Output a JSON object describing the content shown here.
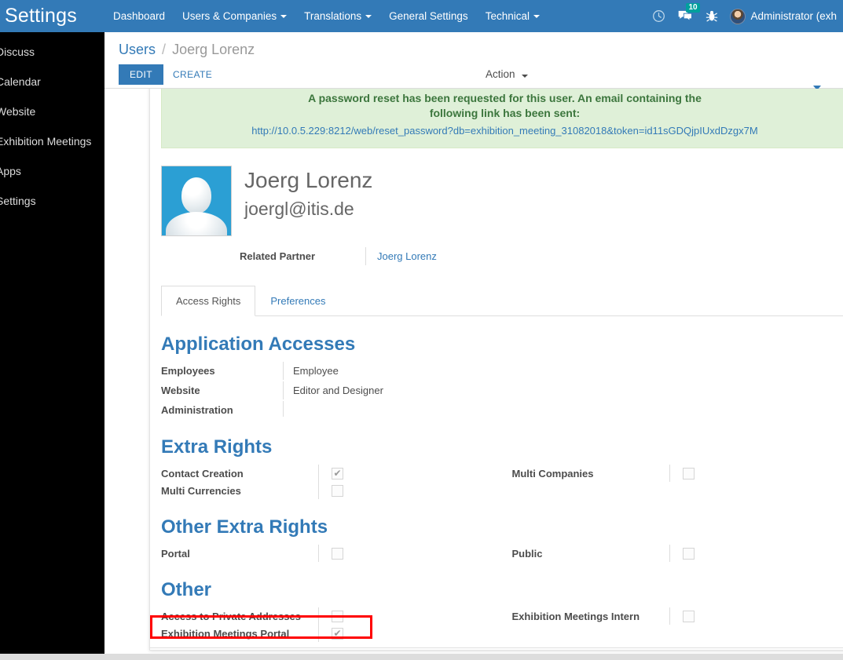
{
  "navbar": {
    "brand": "Settings",
    "menu": [
      {
        "label": "Dashboard",
        "has_caret": false
      },
      {
        "label": "Users & Companies",
        "has_caret": true
      },
      {
        "label": "Translations",
        "has_caret": true
      },
      {
        "label": "General Settings",
        "has_caret": false
      },
      {
        "label": "Technical",
        "has_caret": true
      }
    ],
    "icons": {
      "activity": "clock-icon",
      "messages": "chat-icon",
      "messages_count": "10",
      "debug": "bug-icon"
    },
    "user": "Administrator (exh"
  },
  "sidebar": {
    "items": [
      {
        "label": "Discuss"
      },
      {
        "label": "Calendar"
      },
      {
        "label": "Website"
      },
      {
        "label": "Exhibition Meetings"
      },
      {
        "label": "Apps"
      },
      {
        "label": "Settings"
      }
    ]
  },
  "control_panel": {
    "breadcrumb_root": "Users",
    "breadcrumb_sep": "/",
    "breadcrumb_current": "Joerg Lorenz",
    "edit_label": "EDIT",
    "create_label": "CREATE",
    "action_label": "Action"
  },
  "alert": {
    "line1": "A password reset has been requested for this user. An email containing the",
    "line2": "following link has been sent:",
    "url": "http://10.0.5.229:8212/web/reset_password?db=exhibition_meeting_31082018&token=id11sGDQjpIUxdDzgx7M",
    "close": "×"
  },
  "record": {
    "name": "Joerg Lorenz",
    "email": "joergl@itis.de",
    "related_partner_label": "Related Partner",
    "related_partner_value": "Joerg Lorenz"
  },
  "tabs": [
    {
      "label": "Access Rights",
      "active": true
    },
    {
      "label": "Preferences",
      "active": false
    }
  ],
  "sections": {
    "application_accesses": {
      "title": "Application Accesses",
      "rows": [
        {
          "label": "Employees",
          "value": "Employee"
        },
        {
          "label": "Website",
          "value": "Editor and Designer"
        },
        {
          "label": "Administration",
          "value": ""
        }
      ]
    },
    "extra_rights": {
      "title": "Extra Rights",
      "left": [
        {
          "label": "Contact Creation",
          "checked": true
        },
        {
          "label": "Multi Currencies",
          "checked": false
        }
      ],
      "right": [
        {
          "label": "Multi Companies",
          "checked": false
        }
      ]
    },
    "other_extra_rights": {
      "title": "Other Extra Rights",
      "left": [
        {
          "label": "Portal",
          "checked": false
        }
      ],
      "right": [
        {
          "label": "Public",
          "checked": false
        }
      ]
    },
    "other": {
      "title": "Other",
      "left": [
        {
          "label": "Access to Private Addresses",
          "checked": false
        },
        {
          "label": "Exhibition Meetings Portal",
          "checked": true
        }
      ],
      "right": [
        {
          "label": "Exhibition Meetings Intern",
          "checked": false
        }
      ]
    }
  },
  "annotation": {
    "highlight_color": "#ff0000",
    "highlight_target": "Exhibition Meetings Portal"
  },
  "colors": {
    "navbar": "#337ab7",
    "sidebar": "#000000",
    "section_heading": "#337ab7",
    "alert_bg": "#dff0d8",
    "alert_text": "#3c763d",
    "link": "#337ab7"
  },
  "glyphs": {
    "check": "✔"
  }
}
